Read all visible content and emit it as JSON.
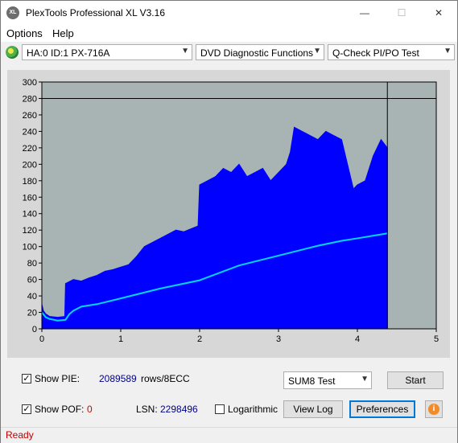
{
  "window": {
    "title": "PlexTools Professional XL V3.16",
    "icon_label": "XL"
  },
  "title_buttons": {
    "minimize": "—",
    "maximize": "☐",
    "close": "✕"
  },
  "menu": {
    "options": "Options",
    "help": "Help"
  },
  "toolbar": {
    "drive": "HA:0 ID:1  PX-716A",
    "function": "DVD Diagnostic Functions",
    "test": "Q-Check PI/PO Test",
    "drive_icon": "disc-icon",
    "dropdown_icon": "chevron-down-icon"
  },
  "chart_data": {
    "type": "area",
    "xlim": [
      0,
      5
    ],
    "ylim": [
      0,
      300
    ],
    "x_ticks": [
      "0",
      "1",
      "2",
      "3",
      "4",
      "5"
    ],
    "y_ticks": [
      "0",
      "20",
      "40",
      "60",
      "80",
      "100",
      "120",
      "140",
      "160",
      "180",
      "200",
      "220",
      "240",
      "260",
      "280",
      "300"
    ],
    "threshold_y": 280,
    "data_end_x": 4.38,
    "grid": false,
    "series": [
      {
        "color": "#0000ff",
        "x": [
          0,
          0.02,
          0.05,
          0.1,
          0.2,
          0.29,
          0.3,
          0.4,
          0.5,
          0.6,
          0.7,
          0.8,
          0.9,
          1.0,
          1.1,
          1.2,
          1.3,
          1.4,
          1.5,
          1.6,
          1.7,
          1.8,
          1.9,
          1.98,
          2.0,
          2.1,
          2.2,
          2.3,
          2.4,
          2.5,
          2.6,
          2.7,
          2.8,
          2.9,
          3.0,
          3.1,
          3.15,
          3.2,
          3.3,
          3.4,
          3.5,
          3.6,
          3.7,
          3.8,
          3.9,
          3.95,
          4.0,
          4.1,
          4.2,
          4.3,
          4.38
        ],
        "y": [
          30,
          22,
          18,
          15,
          14,
          15,
          55,
          60,
          58,
          62,
          65,
          70,
          72,
          75,
          78,
          88,
          100,
          105,
          110,
          115,
          120,
          118,
          122,
          125,
          175,
          180,
          185,
          195,
          190,
          200,
          185,
          190,
          195,
          180,
          190,
          200,
          215,
          245,
          240,
          235,
          230,
          240,
          235,
          230,
          190,
          170,
          175,
          180,
          210,
          230,
          220
        ]
      },
      {
        "color": "#00d7ff",
        "x": [
          0,
          0.05,
          0.1,
          0.2,
          0.3,
          0.35,
          0.4,
          0.5,
          0.7,
          1.0,
          1.5,
          2.0,
          2.5,
          3.0,
          3.5,
          3.8,
          4.0,
          4.38
        ],
        "y": [
          20,
          14,
          12,
          10,
          11,
          18,
          22,
          27,
          30,
          37,
          49,
          59,
          77,
          89,
          101,
          107,
          110,
          116
        ]
      }
    ]
  },
  "controls": {
    "show_pie_label": "Show PIE:",
    "pie_value": "2089589",
    "pie_unit": "rows/8ECC",
    "show_pof_label": "Show POF:",
    "pof_value": "0",
    "lsn_label": "LSN:",
    "lsn_value": "2298496",
    "logarithmic_label": "Logarithmic",
    "sum_mode": "SUM8 Test",
    "start": "Start",
    "view_log": "View Log",
    "preferences": "Preferences",
    "info_icon": "info-icon",
    "checkmark": "✓"
  },
  "status": {
    "text": "Ready"
  }
}
